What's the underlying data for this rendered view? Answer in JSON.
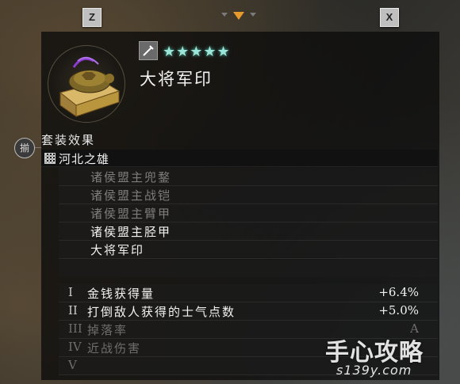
{
  "controls": {
    "left_key": "Z",
    "right_key": "X"
  },
  "item": {
    "name": "大将军印",
    "rarity_stars": "★★★★★",
    "star_color": "#9be6d9"
  },
  "set_effect": {
    "header": "套装效果",
    "side_tab_label": "揃",
    "set_name": "河北之雄",
    "pieces": [
      {
        "label": "诸侯盟主兜鍪",
        "owned": false
      },
      {
        "label": "诸侯盟主战铠",
        "owned": false
      },
      {
        "label": "诸侯盟主臂甲",
        "owned": false
      },
      {
        "label": "诸侯盟主胫甲",
        "owned": true
      },
      {
        "label": "大将军印",
        "owned": true
      }
    ],
    "bonuses": [
      {
        "num": "I",
        "label": "金钱获得量",
        "value": "+6.4%",
        "active": true
      },
      {
        "num": "II",
        "label": "打倒敌人获得的士气点数",
        "value": "+5.0%",
        "active": true
      },
      {
        "num": "III",
        "label": "掉落率",
        "value": "A",
        "active": false
      },
      {
        "num": "IV",
        "label": "近战伤害",
        "value": "",
        "active": false
      },
      {
        "num": "V",
        "label": "",
        "value": "",
        "active": false
      }
    ]
  },
  "watermark": {
    "main": "手心攻略",
    "sub": "s139y.com"
  },
  "colors": {
    "owned_text": "#f2f2f2",
    "missing_text": "#7d7d7d",
    "nav_arrow_active": "#e89a2a"
  }
}
